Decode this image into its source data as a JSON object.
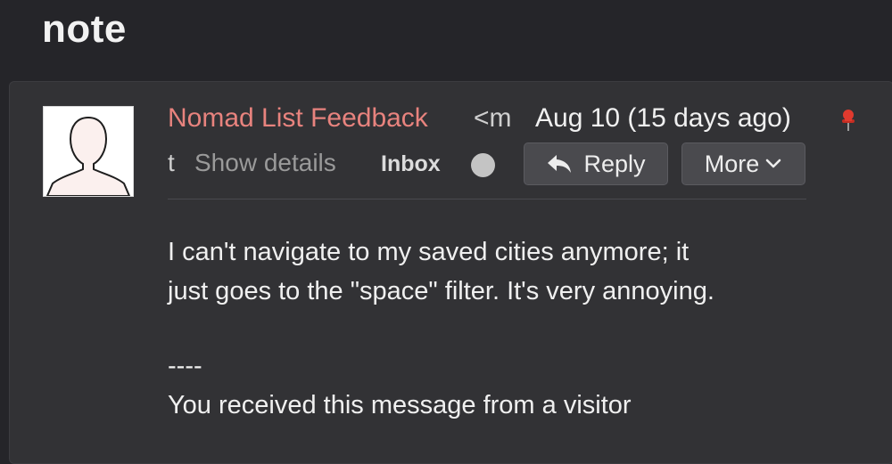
{
  "page": {
    "title": "note"
  },
  "message": {
    "sender_name": "Nomad List Feedback",
    "sender_email_start": "<m",
    "sender_email_end": "t",
    "date": "Aug 10 (15 days ago)",
    "show_details": "Show details",
    "folder": "Inbox",
    "actions": {
      "reply_label": "Reply",
      "more_label": "More"
    },
    "body": {
      "line1": "I can't navigate to my saved cities anymore; it",
      "line2": "just goes to the \"space\" filter. It's very annoying.",
      "separator": "----",
      "footer": "You received this message from a visitor"
    }
  },
  "icons": {
    "avatar": "default-person-avatar",
    "pin": "red-pushpin-icon",
    "reply": "reply-arrow-icon",
    "more": "chevron-down-icon",
    "status": "grey-circle-dot"
  },
  "colors": {
    "background": "#252529",
    "card": "#323235",
    "sender": "#e8837e",
    "pin": "#e03a2e"
  }
}
